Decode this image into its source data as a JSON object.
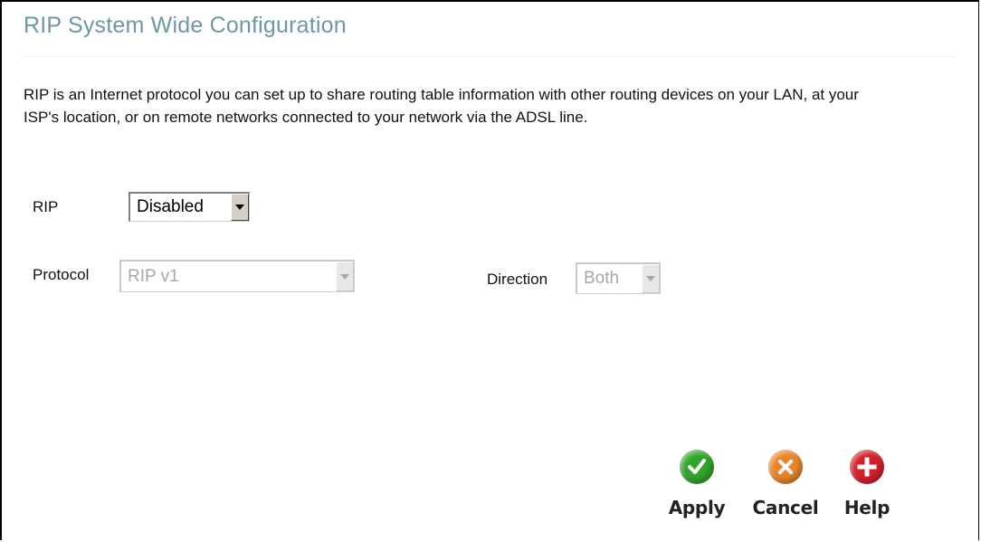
{
  "page": {
    "title": "RIP System Wide Configuration",
    "description": "RIP is an Internet protocol you can set up to share routing table information with other routing devices on your LAN, at your ISP's location, or on remote networks connected to your network via the ADSL line."
  },
  "form": {
    "rip": {
      "label": "RIP",
      "value": "Disabled",
      "enabled": true
    },
    "protocol": {
      "label": "Protocol",
      "value": "RIP v1",
      "enabled": false
    },
    "direction": {
      "label": "Direction",
      "value": "Both",
      "enabled": false
    }
  },
  "actions": {
    "apply": {
      "label": "Apply",
      "icon": "checkmark-icon",
      "color": "#31a52b"
    },
    "cancel": {
      "label": "Cancel",
      "icon": "x-icon",
      "color": "#e8852a"
    },
    "help": {
      "label": "Help",
      "icon": "plus-icon",
      "color": "#d3202a"
    }
  }
}
